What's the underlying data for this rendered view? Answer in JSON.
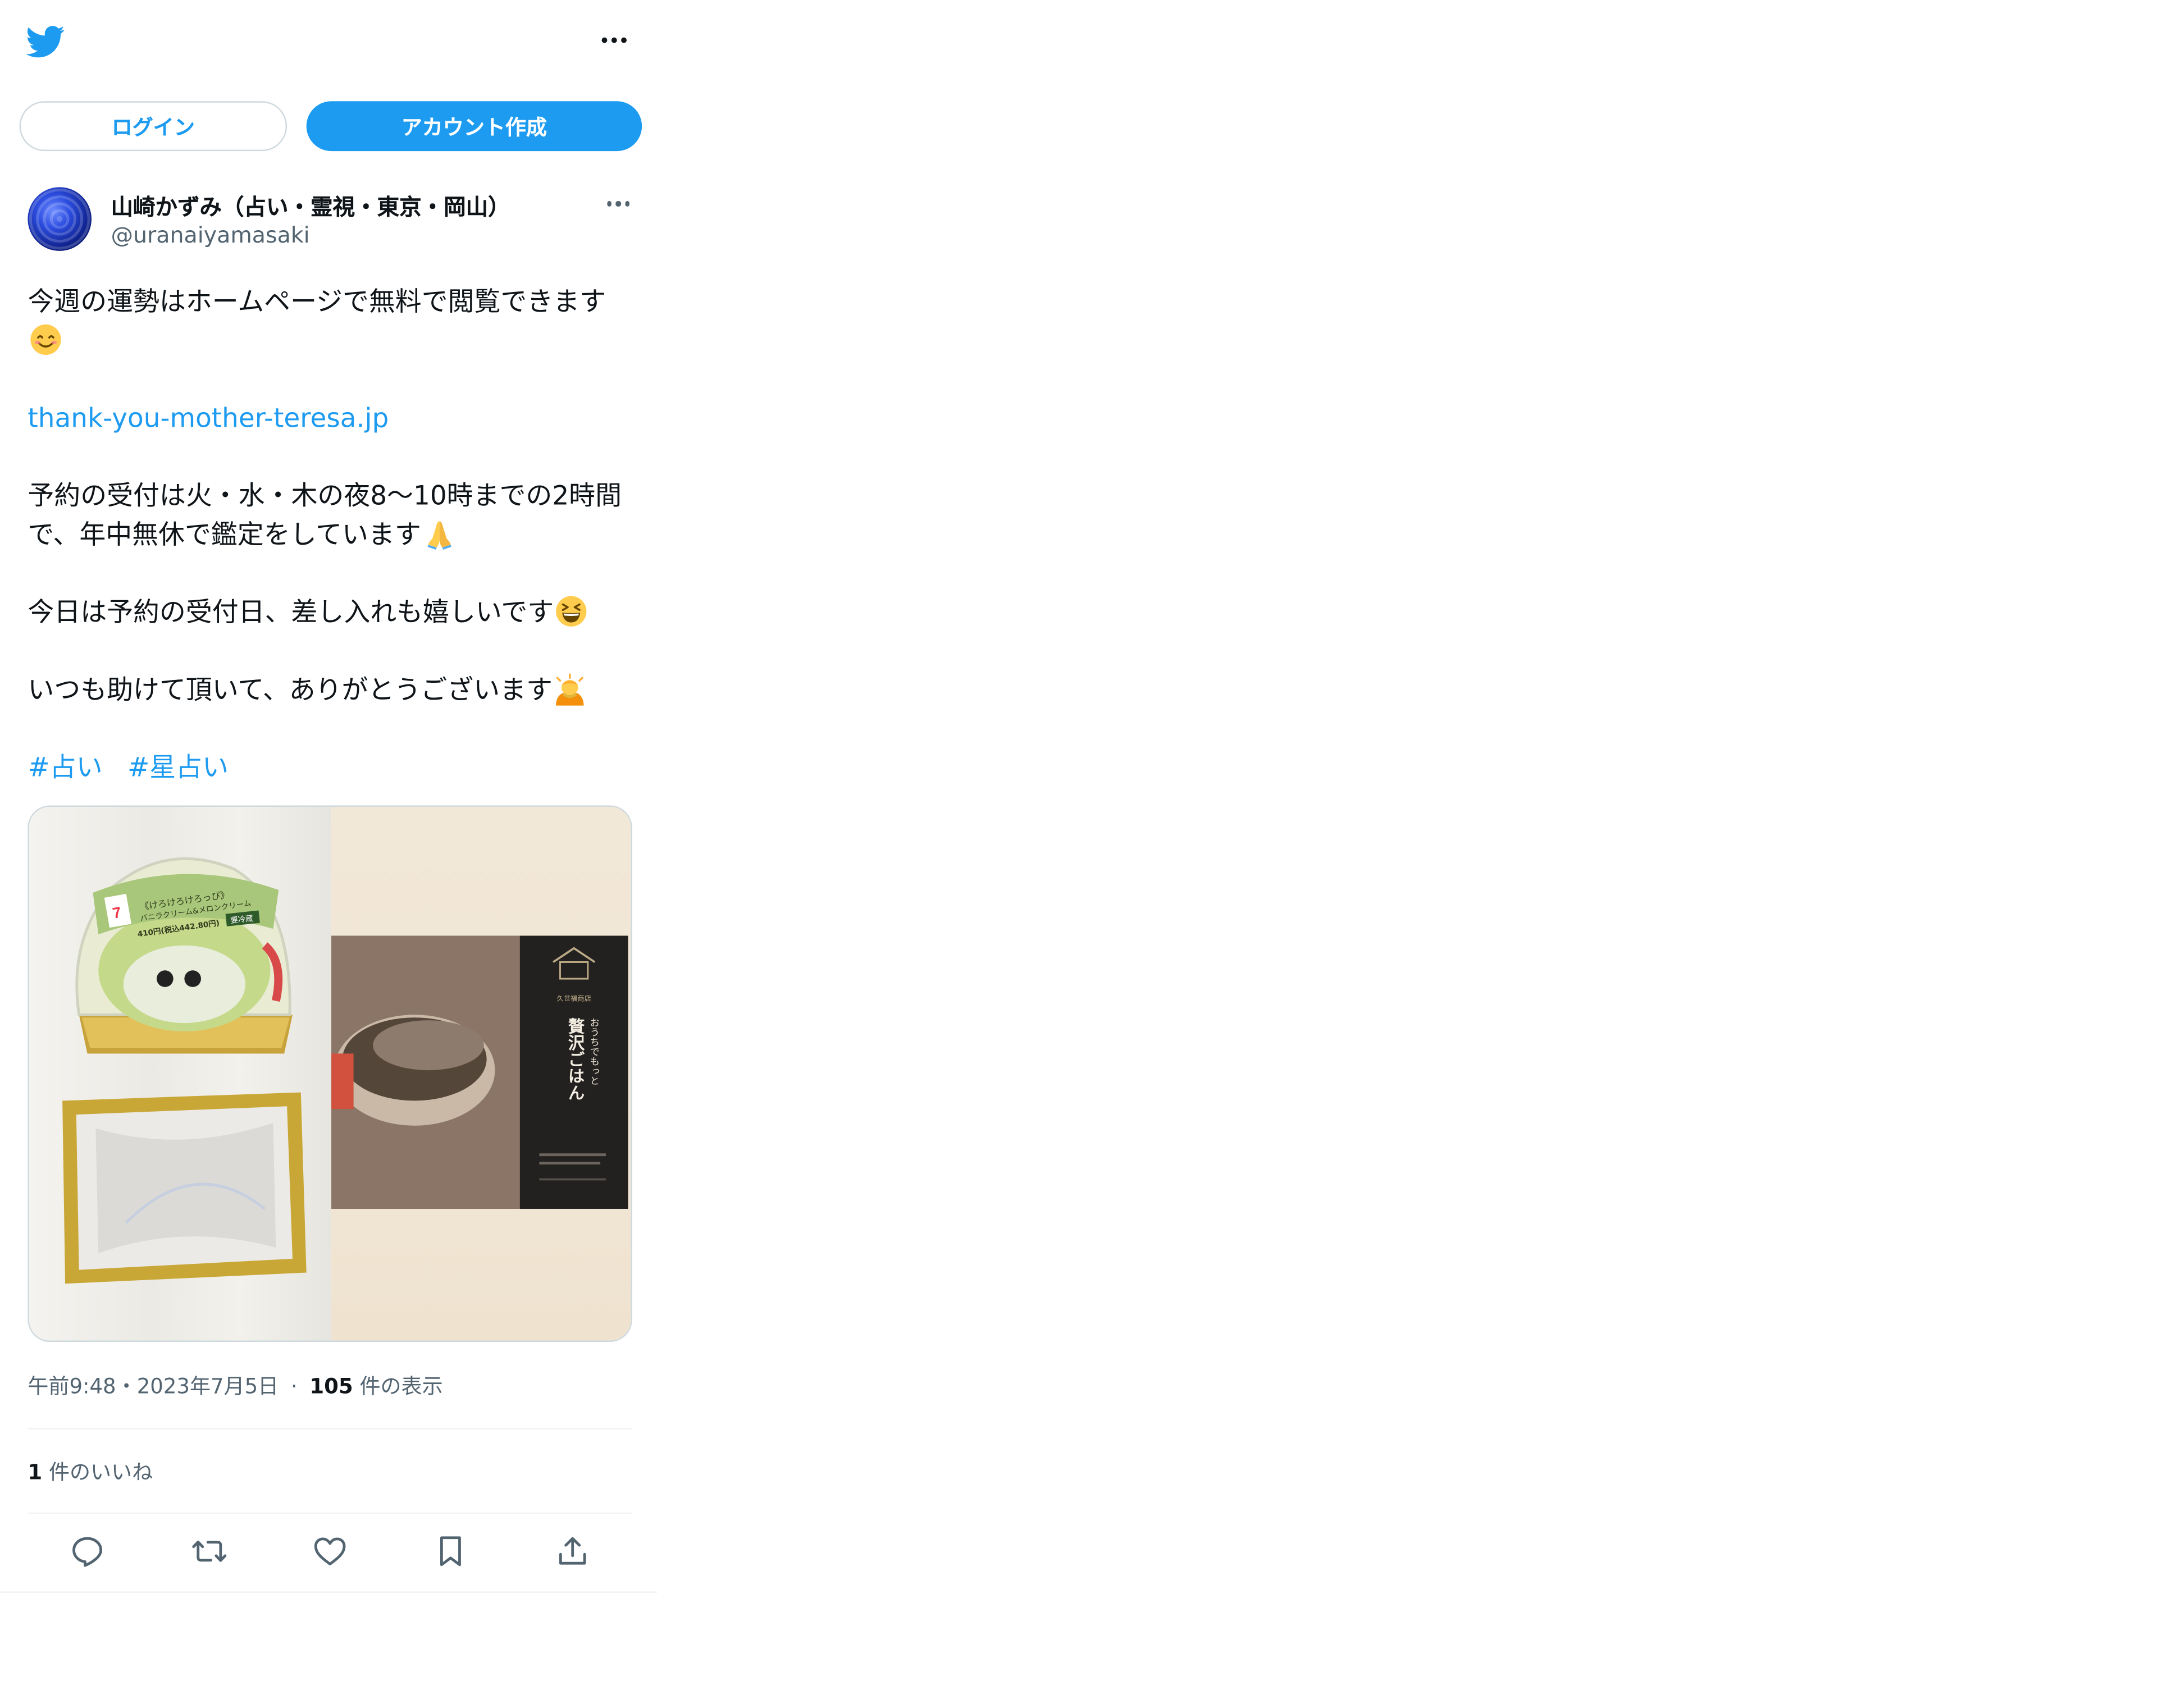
{
  "header": {
    "login_label": "ログイン",
    "signup_label": "アカウント作成"
  },
  "author": {
    "name": "山崎かずみ（占い・霊視・東京・岡山）",
    "handle": "@uranaiyamasaki"
  },
  "tweet": {
    "line1": "今週の運勢はホームページで無料で閲覧できます",
    "link": "thank-you-mother-teresa.jp",
    "line3a": "予約の受付は火・水・木の夜8〜10時までの2時間",
    "line3b": "で、年中無休で鑑定をしています",
    "line4": "今日は予約の受付日、差し入れも嬉しいです",
    "line5": "いつも助けて頂いて、ありがとうございます",
    "hashtags": [
      "#占い",
      "#星占い"
    ]
  },
  "media": {
    "left_label_top": "《けろけろけろっぴ》",
    "left_label_sub": "バニラクリーム&メロンクリーム",
    "left_price": "410円(税込442.80円)",
    "left_tag": "要冷蔵",
    "right_brand": "久世福商店",
    "right_title_small": "おうちでもっと",
    "right_title": "贅沢ごはん"
  },
  "meta": {
    "time": "午前9:48",
    "sep": "・",
    "date": "2023年7月5日",
    "dot": "·",
    "views_count": "105",
    "views_label": "件の表示"
  },
  "engagement": {
    "likes_count": "1",
    "likes_label": "件のいいね"
  },
  "colors": {
    "accent": "#1d9bf0",
    "text": "#0f1419",
    "secondary": "#536471",
    "border": "#cfd9de"
  },
  "icons": {
    "brand": "twitter-bird-icon",
    "more": "more-dots-icon",
    "emoji1": "smiling-face-icon",
    "emoji2": "folded-hands-icon",
    "emoji3": "grinning-squinting-face-icon",
    "emoji4": "person-bowing-icon",
    "actions": [
      "reply-icon",
      "retweet-icon",
      "like-icon",
      "bookmark-icon",
      "share-icon"
    ]
  }
}
